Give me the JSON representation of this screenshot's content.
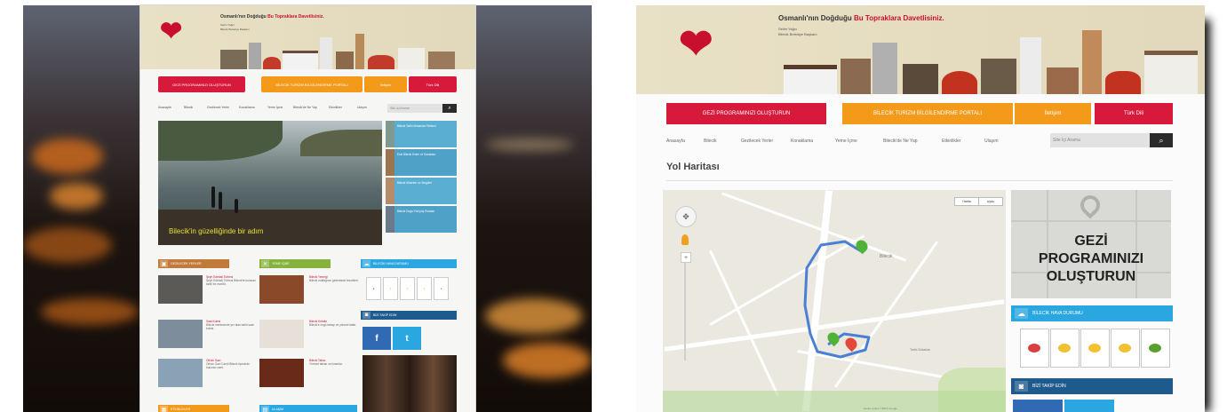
{
  "left": {
    "banner": {
      "headline": "Osmanlı'nın Doğduğu",
      "headline_accent": "Bu Topraklara Davetlisiniz.",
      "subline_1": "Selim Yağcı",
      "subline_2": "Bilecik Belediye Başkanı"
    },
    "nav": {
      "program_btn": "GEZİ PROGRAMINIZI OLUŞTURUN",
      "middle_btn": "BİLECİK TURİZM BİLGİLENDİRME PORTALI",
      "orange_btn": "İletişim",
      "red_btn": "Türk Dili"
    },
    "menu": [
      "Anasayfa",
      "Bilecik",
      "Gezilecek Yerler",
      "Konaklama",
      "Yeme İçme",
      "Bilecik'de Ne Yap",
      "Etkinlikler",
      "Ulaşım"
    ],
    "search": {
      "placeholder": "Site İçi Arama"
    },
    "hero": {
      "caption": "Bilecik'in güzelliğinde bir adım"
    },
    "sidebar_items": [
      "Bilecik Tarihi Mekanlar Rehberi",
      "Eski Bilecik Evleri ve Sokakları",
      "Bilecik Müzeleri ve Sergileri",
      "Bilecik Doğa Yürüyüş Rotaları"
    ],
    "sections": {
      "places_title": "GEZİLECEK YERLER",
      "food_title": "YEME İÇME",
      "weather_title": "BİLECİK HAVA DURUMU",
      "follow_title": "BİZİ TAKİP EDİN",
      "bottom_left": "ETKİNLİKLER",
      "bottom_mid": "ULAŞIM"
    },
    "places": [
      {
        "title": "Şeyh Edebali Türbesi",
        "text": "Şeyh Edebali Türbesi Bilecik'te bulunan tarihi bir eserdir."
      },
      {
        "title": "Saat Kulesi",
        "text": "Bilecik merkezinde yer alan tarihi saat kulesi."
      },
      {
        "title": "Orhan Gazi",
        "text": "Orhan Gazi Camii Bilecik ilçesinde bulunan cami."
      }
    ],
    "foods": [
      {
        "title": "Bilecik Yemeği",
        "text": "Bilecik mutfağının geleneksel lezzetleri."
      },
      {
        "title": "Bilecik Kebabı",
        "text": "Bilecik'e özgü kebap ve yöresel tatlar."
      },
      {
        "title": "Bilecik Tatlısı",
        "text": "Yöresel tatlılar ve ikramlar."
      }
    ],
    "social": {
      "facebook": "f",
      "twitter": "t"
    }
  },
  "right": {
    "banner": {
      "headline": "Osmanlı'nın Doğduğu",
      "headline_accent": "Bu Topraklara Davetlisiniz.",
      "subline_1": "Selim Yağcı",
      "subline_2": "Bilecik Belediye Başkanı"
    },
    "nav": {
      "program_btn": "GEZİ PROGRAMINIZI OLUŞTURUN",
      "middle_btn": "BİLECİK TURİZM BİLGİLENDİRME PORTALI",
      "orange_btn": "İletişim",
      "red_btn": "Türk Dili"
    },
    "menu": [
      "Anasayfa",
      "Bilecik",
      "Gezilecek Yerler",
      "Konaklama",
      "Yeme İçme",
      "Bilecik'de Ne Yap",
      "Etkinlikler",
      "Ulaşım"
    ],
    "search": {
      "placeholder": "Site İçi Arama"
    },
    "page_title": "Yol Haritası",
    "map": {
      "btn_map": "Harita",
      "btn_sat": "Uydu",
      "label_1": "Bilecik",
      "label_2": "Tarihi Sokaklar",
      "footer": "Harita verileri ©2014 Google"
    },
    "gezi": {
      "line1": "GEZİ",
      "line2": "PROGRAMINIZI",
      "line3": "OLUŞTURUN"
    },
    "weather_title": "BİLECİK HAVA DURUMU",
    "follow_title": "BİZİ TAKİP EDİN"
  },
  "colors": {
    "red": "#d71a3c",
    "orange": "#f39a1b",
    "brown": "#c17a3a",
    "green": "#86b33b",
    "blue": "#2aa6e0",
    "darkblue": "#1f5a8c"
  }
}
